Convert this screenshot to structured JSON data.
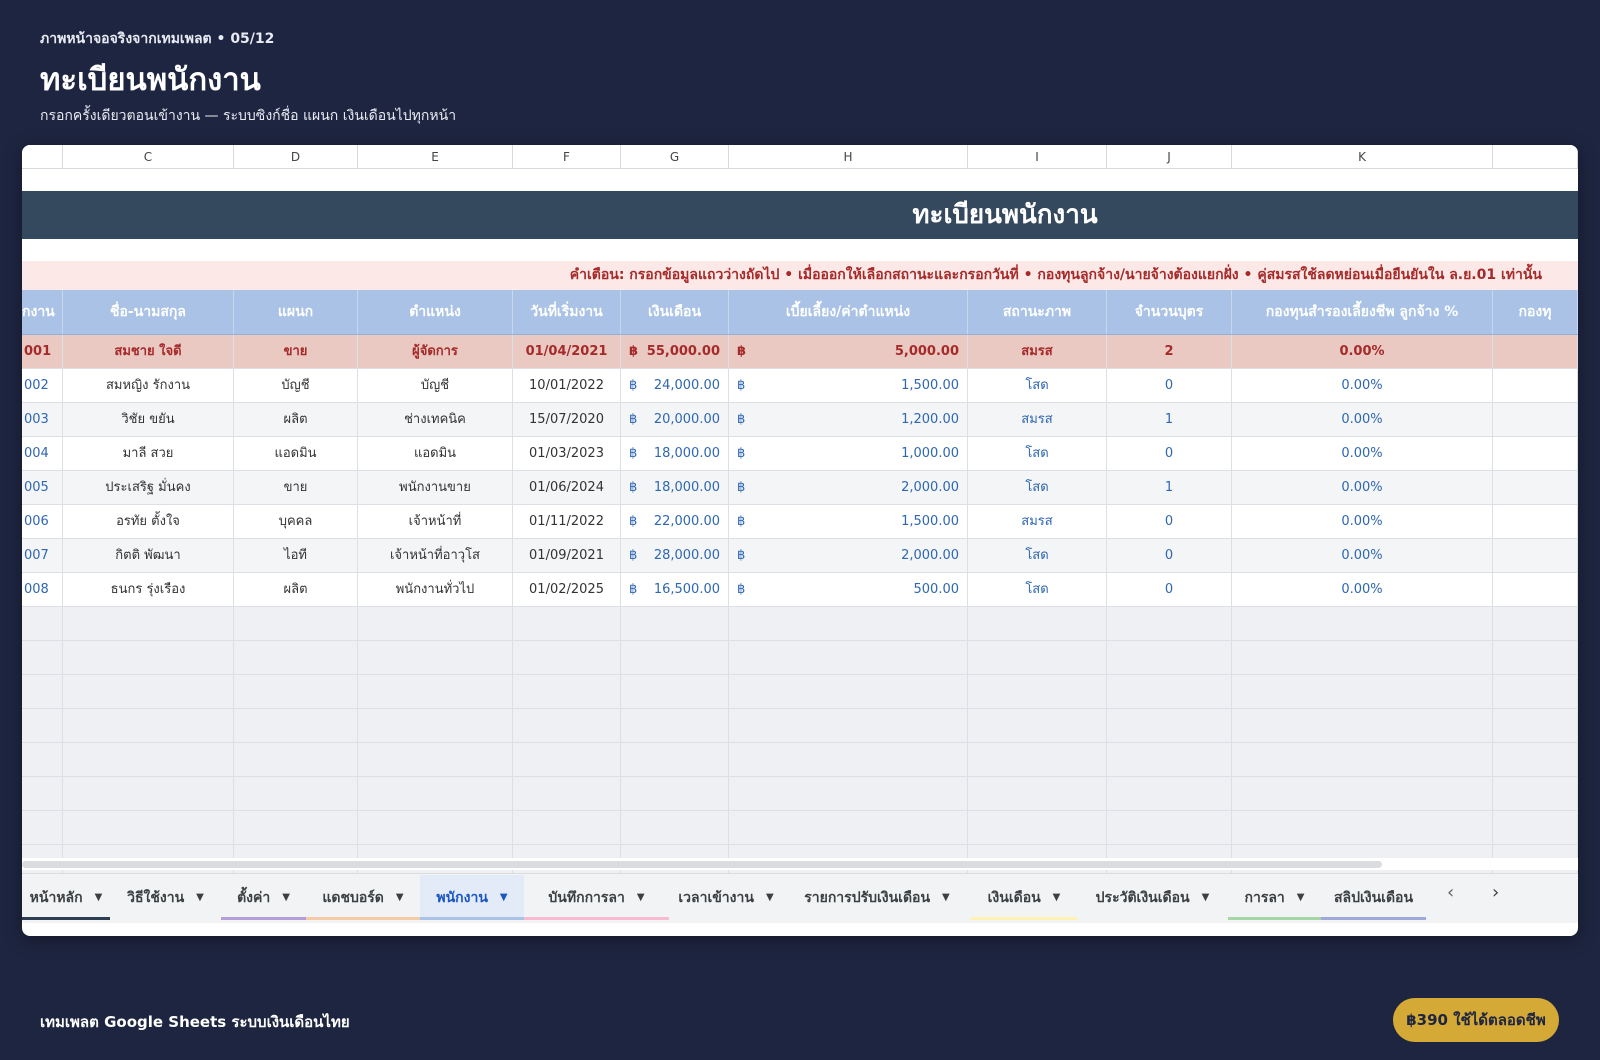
{
  "page": {
    "kicker": "ภาพหน้าจอจริงจากเทมเพลต • 05/12",
    "title": "ทะเบียนพนักงาน",
    "subtitle": "กรอกครั้งเดียวตอนเข้างาน — ระบบซิงก์ชื่อ แผนก เงินเดือนไปทุกหน้า"
  },
  "sheet": {
    "column_letters": [
      "",
      "C",
      "D",
      "E",
      "F",
      "G",
      "H",
      "I",
      "J",
      "K",
      ""
    ],
    "banner_title": "ทะเบียนพนักงาน",
    "warning": "คำเตือน: กรอกข้อมูลแถวว่างถัดไป • เมื่อออกให้เลือกสถานะและกรอกวันที่ • กองทุนลูกจ้าง/นายจ้างต้องแยกฝั่ง • คู่สมรสใช้ลดหย่อนเมื่อยืนยันใน ล.ย.01 เท่านั้น",
    "headers": [
      "กงาน",
      "ชื่อ-นามสกุล",
      "แผนก",
      "ตำแหน่ง",
      "วันที่เริ่มงาน",
      "เงินเดือน",
      "เบี้ยเลี้ยง/ค่าตำแหน่ง",
      "สถานะภาพ",
      "จำนวนบุตร",
      "กองทุนสำรองเลี้ยงชีพ ลูกจ้าง %",
      "กองทุ"
    ],
    "currency_symbol": "฿",
    "rows": [
      {
        "id": "001",
        "name": "สมชาย ใจดี",
        "dept": "ขาย",
        "position": "ผู้จัดการ",
        "start": "01/04/2021",
        "salary": "55,000.00",
        "allowance": "5,000.00",
        "status": "สมรส",
        "children": "2",
        "pvd": "0.00%"
      },
      {
        "id": "002",
        "name": "สมหญิง รักงาน",
        "dept": "บัญชี",
        "position": "บัญชี",
        "start": "10/01/2022",
        "salary": "24,000.00",
        "allowance": "1,500.00",
        "status": "โสด",
        "children": "0",
        "pvd": "0.00%"
      },
      {
        "id": "003",
        "name": "วิชัย ขยัน",
        "dept": "ผลิต",
        "position": "ช่างเทคนิค",
        "start": "15/07/2020",
        "salary": "20,000.00",
        "allowance": "1,200.00",
        "status": "สมรส",
        "children": "1",
        "pvd": "0.00%"
      },
      {
        "id": "004",
        "name": "มาลี สวย",
        "dept": "แอดมิน",
        "position": "แอดมิน",
        "start": "01/03/2023",
        "salary": "18,000.00",
        "allowance": "1,000.00",
        "status": "โสด",
        "children": "0",
        "pvd": "0.00%"
      },
      {
        "id": "005",
        "name": "ประเสริฐ มั่นคง",
        "dept": "ขาย",
        "position": "พนักงานขาย",
        "start": "01/06/2024",
        "salary": "18,000.00",
        "allowance": "2,000.00",
        "status": "โสด",
        "children": "1",
        "pvd": "0.00%"
      },
      {
        "id": "006",
        "name": "อรทัย ตั้งใจ",
        "dept": "บุคคล",
        "position": "เจ้าหน้าที่",
        "start": "01/11/2022",
        "salary": "22,000.00",
        "allowance": "1,500.00",
        "status": "สมรส",
        "children": "0",
        "pvd": "0.00%"
      },
      {
        "id": "007",
        "name": "กิตติ พัฒนา",
        "dept": "ไอที",
        "position": "เจ้าหน้าที่อาวุโส",
        "start": "01/09/2021",
        "salary": "28,000.00",
        "allowance": "2,000.00",
        "status": "โสด",
        "children": "0",
        "pvd": "0.00%"
      },
      {
        "id": "008",
        "name": "ธนกร รุ่งเรือง",
        "dept": "ผลิต",
        "position": "พนักงานทั่วไป",
        "start": "01/02/2025",
        "salary": "16,500.00",
        "allowance": "500.00",
        "status": "โสด",
        "children": "0",
        "pvd": "0.00%"
      }
    ],
    "tabs": [
      {
        "label": "หน้าหลัก",
        "color": "#2c3e50",
        "active": false
      },
      {
        "label": "วิธีใช้งาน",
        "color": "",
        "active": false
      },
      {
        "label": "ตั้งค่า",
        "color": "#b39ddb",
        "active": false
      },
      {
        "label": "แดชบอร์ด",
        "color": "#f5cba7",
        "active": false
      },
      {
        "label": "พนักงาน",
        "color": "#a9c2e5",
        "active": true
      },
      {
        "label": "บันทึกการลา",
        "color": "#f8bbd0",
        "active": false
      },
      {
        "label": "เวลาเข้างาน",
        "color": "",
        "active": false
      },
      {
        "label": "รายการปรับเงินเดือน",
        "color": "",
        "active": false
      },
      {
        "label": "เงินเดือน",
        "color": "#fff3b0",
        "active": false
      },
      {
        "label": "ประวัติเงินเดือน",
        "color": "",
        "active": false
      },
      {
        "label": "การลา",
        "color": "#a5d6a7",
        "active": false
      },
      {
        "label": "สลิปเงินเดือน",
        "color": "#9fa8da",
        "active": false
      }
    ]
  },
  "footer": {
    "text": "เทมเพลต Google Sheets ระบบเงินเดือนไทย",
    "price_button": "฿390 ใช้ได้ตลอดชีพ"
  }
}
